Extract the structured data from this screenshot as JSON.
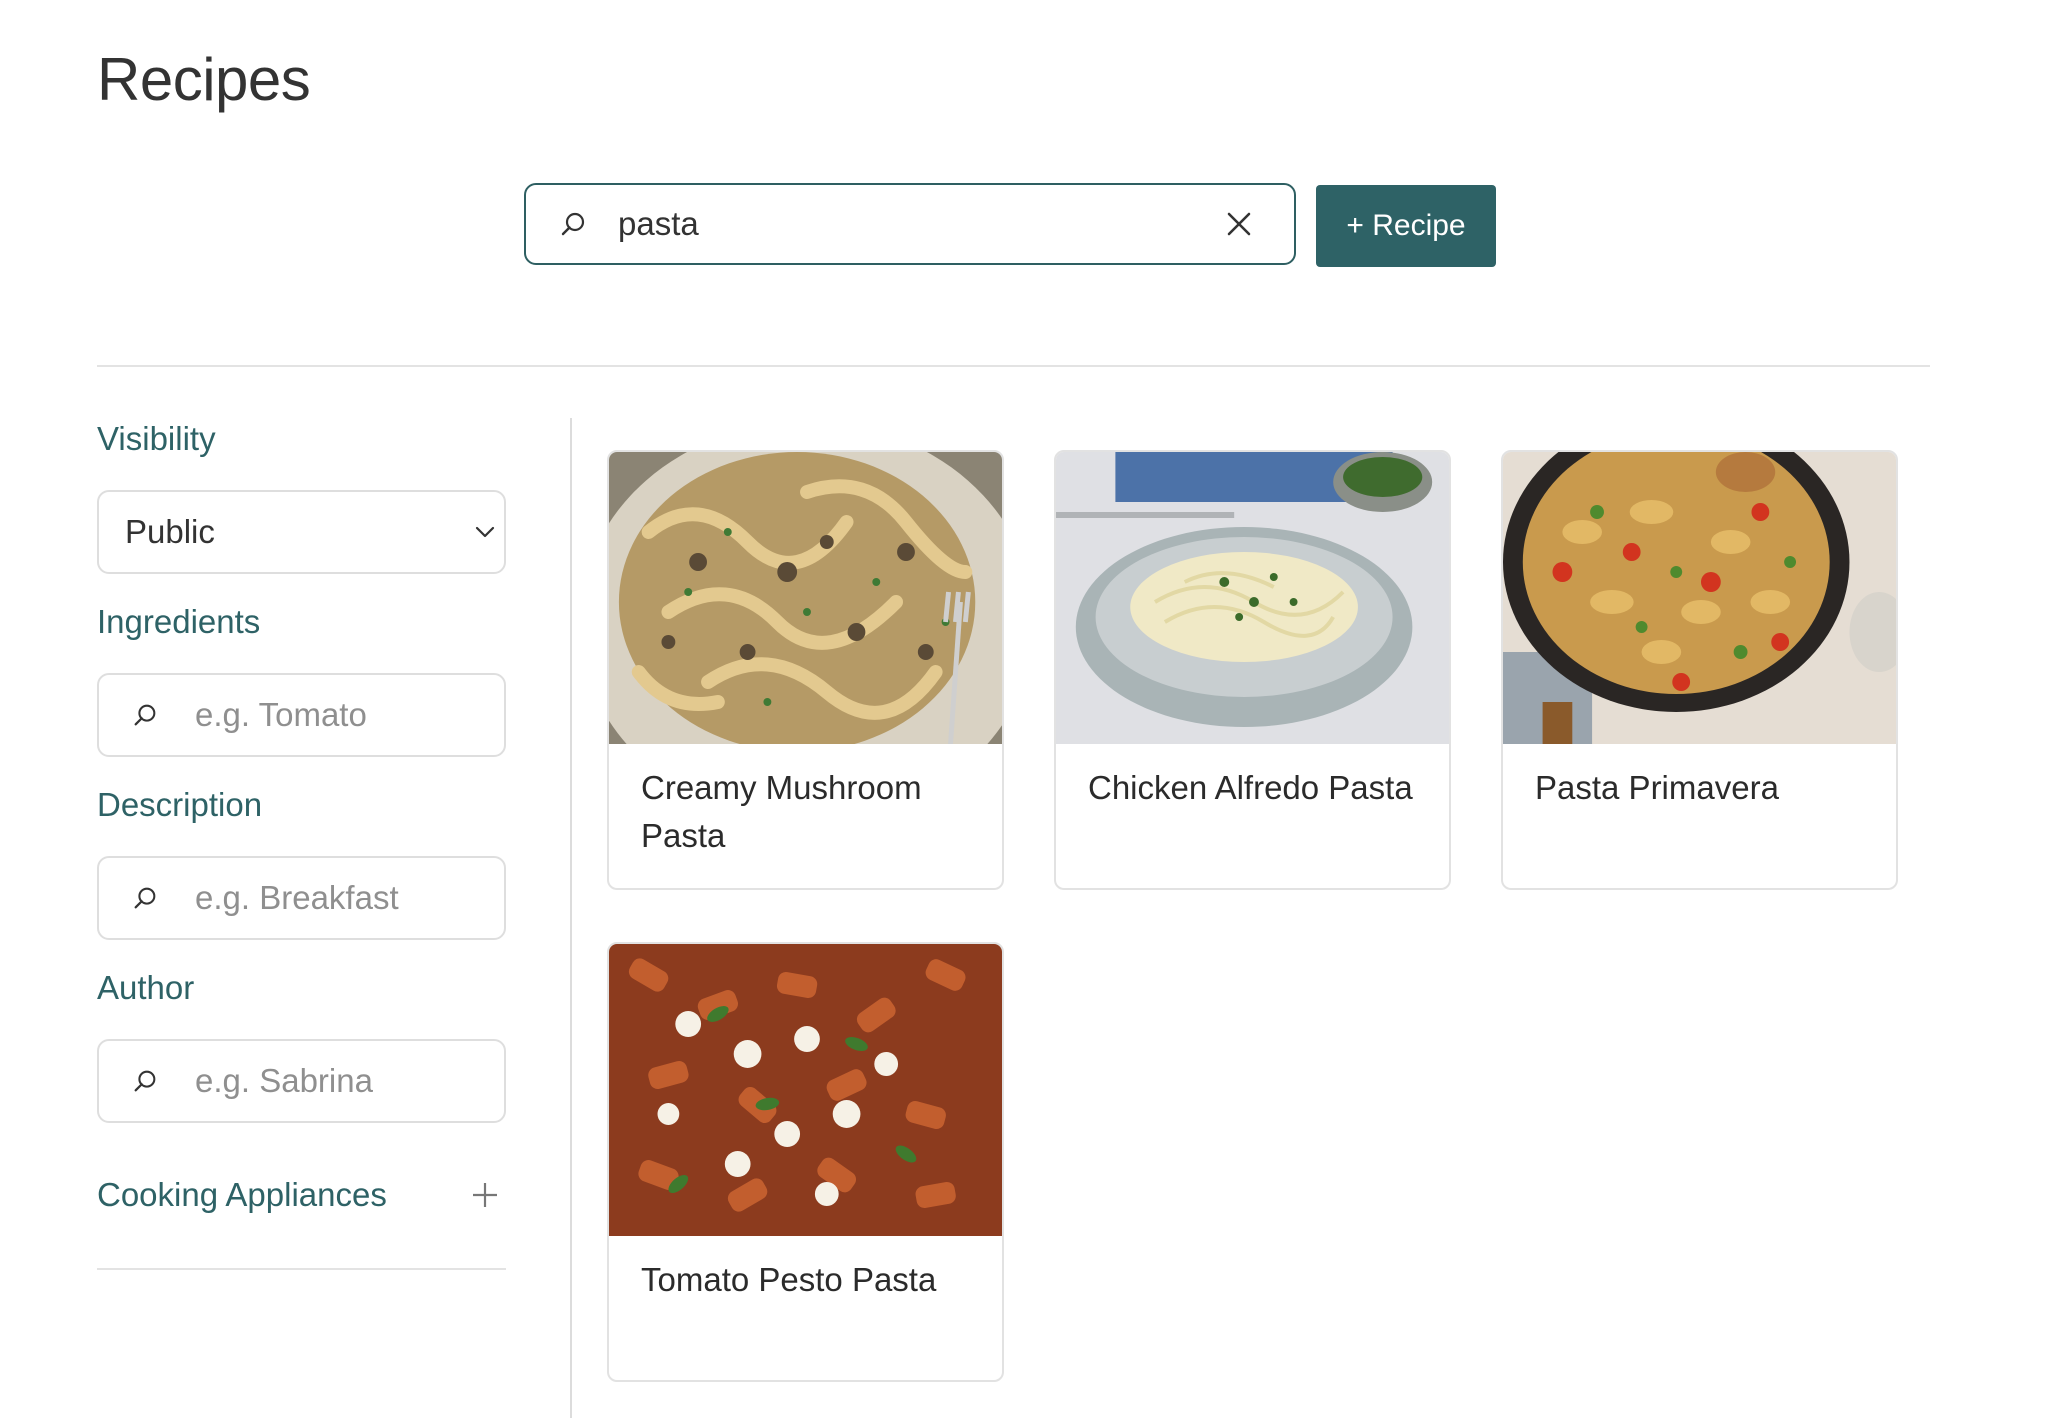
{
  "page": {
    "title": "Recipes"
  },
  "search": {
    "value": "pasta",
    "icon": "search-icon",
    "clear_icon": "close-icon"
  },
  "actions": {
    "add_recipe_label": "+ Recipe"
  },
  "filters": {
    "visibility": {
      "label": "Visibility",
      "selected": "Public",
      "icon": "chevron-down-icon"
    },
    "ingredients": {
      "label": "Ingredients",
      "placeholder": "e.g. Tomato"
    },
    "description": {
      "label": "Description",
      "placeholder": "e.g. Breakfast"
    },
    "author": {
      "label": "Author",
      "placeholder": "e.g. Sabrina"
    },
    "cooking_appliances": {
      "label": "Cooking Appliances",
      "icon": "plus-icon"
    }
  },
  "recipes": [
    {
      "title": "Creamy Mushroom Pasta"
    },
    {
      "title": "Chicken Alfredo Pasta"
    },
    {
      "title": "Pasta Primavera"
    },
    {
      "title": "Tomato Pesto Pasta"
    }
  ],
  "colors": {
    "accent": "#2e6266",
    "border": "#dedede",
    "text": "#2b2b2b"
  }
}
